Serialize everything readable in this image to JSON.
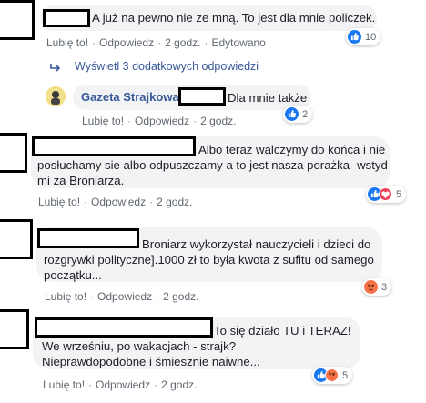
{
  "actions": {
    "like": "Lubię to!",
    "reply": "Odpowiedz",
    "sep": "·"
  },
  "comments": [
    {
      "text": "A już na pewno nie ze mną. To jest dla mnie policzek.",
      "time": "2 godz.",
      "edited": "Edytowano",
      "reactions": [
        "like"
      ],
      "count": "10"
    },
    {
      "text": "Dla mnie także",
      "author": "Gazeta Strajkowa",
      "time": "2 godz.",
      "reactions": [
        "like"
      ],
      "count": "2"
    },
    {
      "lines": [
        "Albo teraz walczymy do końca i nie",
        "posłuchamy sie albo odpuszczamy a to jest nasza porażka- wstyd",
        "mi za Broniarza."
      ],
      "time": "2 godz.",
      "reactions": [
        "like",
        "love"
      ],
      "count": "5"
    },
    {
      "lines": [
        "Broniarz wykorzystał nauczycieli i dzieci do",
        "rozgrywki polityczne].1000 zł to była kwota z sufitu od samego",
        "początku..."
      ],
      "time": "2 godz.",
      "reactions": [
        "angry"
      ],
      "count": "3"
    },
    {
      "lines": [
        "To się działo TU i TERAZ!",
        "We wrześniu, po wakacjach - strajk?",
        "Nieprawdopodobne i śmiesznie naiwne..."
      ],
      "time": "2 godz.",
      "reactions": [
        "like",
        "angry"
      ],
      "count": "5"
    }
  ],
  "more_replies": "Wyświetl 3 dodatkowych odpowiedzi",
  "colors": {
    "bubble": "#f2f3f5",
    "link": "#385898",
    "meta": "#606770",
    "like": "#1877f2",
    "love": "#f33e58",
    "angry": "#f7714b"
  }
}
